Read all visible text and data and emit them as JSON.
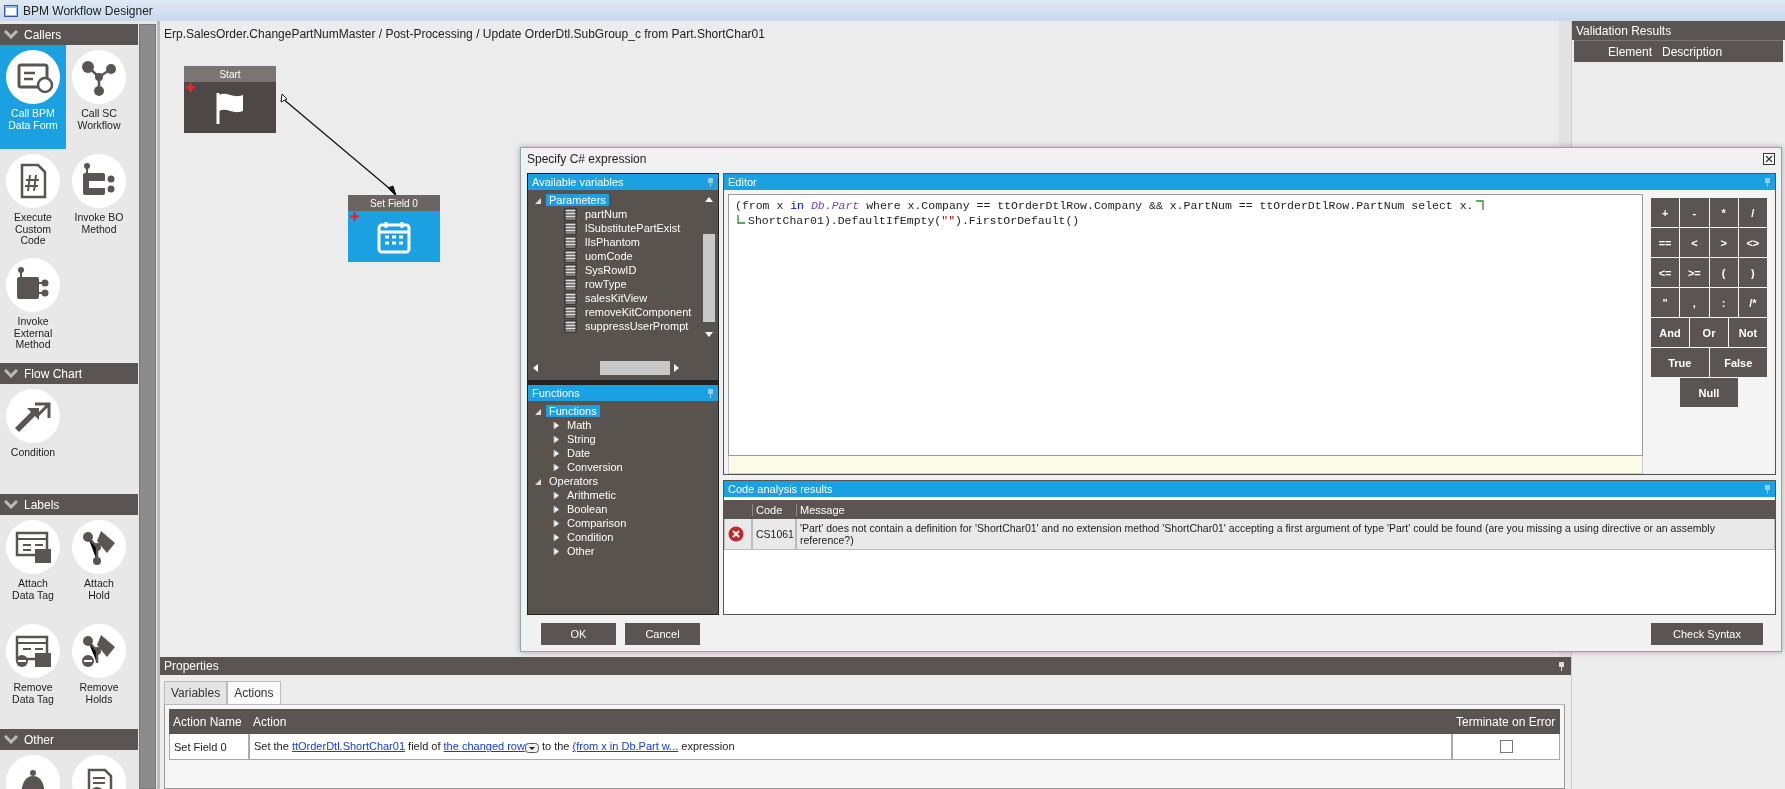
{
  "window": {
    "title": "BPM Workflow Designer"
  },
  "toolbox": {
    "sections": [
      {
        "title": "Callers",
        "items": [
          {
            "label": "Call BPM Data Form",
            "selected": true
          },
          {
            "label": "Call SC Workflow",
            "selected": false
          },
          {
            "label": "Execute Custom Code",
            "selected": false
          },
          {
            "label": "Invoke BO Method",
            "selected": false
          },
          {
            "label": "Invoke External Method",
            "selected": false
          }
        ]
      },
      {
        "title": "Flow Chart",
        "items": [
          {
            "label": "Condition",
            "selected": false
          }
        ]
      },
      {
        "title": "Labels",
        "items": [
          {
            "label": "Attach Data Tag",
            "selected": false
          },
          {
            "label": "Attach Hold",
            "selected": false
          },
          {
            "label": "Remove Data Tag",
            "selected": false
          },
          {
            "label": "Remove Holds",
            "selected": false
          }
        ]
      },
      {
        "title": "Other",
        "items": [
          {
            "selected": false
          },
          {
            "selected": false
          }
        ]
      }
    ]
  },
  "canvas": {
    "breadcrumb": "Erp.SalesOrder.ChangePartNumMaster / Post-Processing / Update OrderDtl.SubGroup_c from Part.ShortChar01",
    "nodes": [
      {
        "kind": "start",
        "title": "Start",
        "selected": false
      },
      {
        "kind": "set-field",
        "title": "Set Field 0",
        "selected": true
      }
    ]
  },
  "validation": {
    "title": "Validation Results",
    "columns": [
      "Element",
      "Description"
    ]
  },
  "dialog": {
    "title": "Specify C# expression",
    "variables": {
      "title": "Available variables",
      "tree": [
        {
          "label": "Parameters",
          "selected": true,
          "expanded": true,
          "children": [
            {
              "label": "partNum"
            },
            {
              "label": "lSubstitutePartExist"
            },
            {
              "label": "lIsPhantom"
            },
            {
              "label": "uomCode"
            },
            {
              "label": "SysRowID"
            },
            {
              "label": "rowType"
            },
            {
              "label": "salesKitView"
            },
            {
              "label": "removeKitComponent"
            },
            {
              "label": "suppressUserPrompt"
            }
          ]
        }
      ]
    },
    "functions": {
      "title": "Functions",
      "tree": [
        {
          "label": "Functions",
          "selected": true,
          "expanded": true,
          "children": [
            {
              "label": "Math",
              "expanded": false
            },
            {
              "label": "String",
              "expanded": false
            },
            {
              "label": "Date",
              "expanded": false
            },
            {
              "label": "Conversion",
              "expanded": false
            }
          ]
        },
        {
          "label": "Operators",
          "selected": false,
          "expanded": true,
          "children": [
            {
              "label": "Arithmetic",
              "expanded": false
            },
            {
              "label": "Boolean",
              "expanded": false
            },
            {
              "label": "Comparison",
              "expanded": false
            },
            {
              "label": "Condition",
              "expanded": false
            },
            {
              "label": "Other",
              "expanded": false
            }
          ]
        }
      ]
    },
    "editor": {
      "title": "Editor",
      "lines": [
        {
          "wraps_on": true,
          "segments": [
            {
              "kind": "plain",
              "text": "(from x "
            },
            {
              "kind": "keyword",
              "text": "in"
            },
            {
              "kind": "type",
              "text": " Db.Part"
            },
            {
              "kind": "plain",
              "text": " where x.Company == ttOrderDtlRow.Company && x.PartNum == ttOrderDtlRow.PartNum select x."
            }
          ]
        },
        {
          "continued": true,
          "segments": [
            {
              "kind": "plain",
              "text": "ShortChar01).DefaultIfEmpty("
            },
            {
              "kind": "string",
              "text": "\"\""
            },
            {
              "kind": "plain",
              "text": ").FirstOrDefault()"
            }
          ]
        }
      ]
    },
    "keypad": [
      [
        "+",
        "-",
        "*",
        "/"
      ],
      [
        "==",
        "<",
        ">",
        "<>"
      ],
      [
        "<=",
        ">=",
        "(",
        ")"
      ],
      [
        "\"",
        ",",
        ":",
        "/*"
      ],
      [
        "And",
        "Or",
        "Not"
      ],
      [
        "True",
        "False"
      ],
      [
        "Null"
      ]
    ],
    "analysis": {
      "title": "Code analysis results",
      "columns": [
        "Code",
        "Message"
      ],
      "rows": [
        {
          "error": true,
          "code": "CS1061",
          "message": "'Part' does not contain a definition for 'ShortChar01' and no extension method 'ShortChar01' accepting a first argument of type 'Part' could be found (are you missing a using directive or an assembly reference?)"
        }
      ]
    },
    "buttons": {
      "ok": "OK",
      "cancel": "Cancel",
      "check": "Check Syntax"
    }
  },
  "properties": {
    "title": "Properties",
    "tabs": [
      {
        "label": "Variables",
        "selected": false
      },
      {
        "label": "Actions",
        "selected": true
      }
    ],
    "columns": [
      "Action Name",
      "Action",
      "Terminate on Error"
    ],
    "rows": [
      {
        "name": "Set Field 0",
        "terminate_on_error": false,
        "action": [
          {
            "kind": "text",
            "text": "Set the "
          },
          {
            "kind": "link",
            "text": "ttOrderDtl.ShortChar01"
          },
          {
            "kind": "text",
            "text": " field of "
          },
          {
            "kind": "link",
            "text": "the changed row"
          },
          {
            "kind": "dropdown"
          },
          {
            "kind": "text",
            "text": " to the "
          },
          {
            "kind": "link",
            "text": "(from x in Db.Part w..."
          },
          {
            "kind": "text",
            "text": " expression"
          }
        ]
      }
    ]
  }
}
